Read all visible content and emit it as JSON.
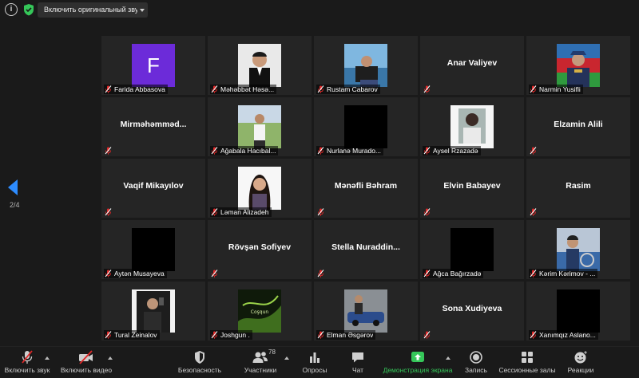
{
  "topbar": {
    "original_sound_label": "Включить оригинальный звук"
  },
  "pager": {
    "page_label": "2/4"
  },
  "participants": [
    {
      "name": "Farida Abbasova",
      "display": "avatar",
      "initial": "F",
      "avatar_color": "#6c2bd9"
    },
    {
      "name": "Məhəbbət Həsə...",
      "display": "photo"
    },
    {
      "name": "Rustam Cabarov",
      "display": "photo"
    },
    {
      "name": "Anar Valiyev",
      "display": "name"
    },
    {
      "name": "Narmin Yusifli",
      "display": "photo"
    },
    {
      "name": "Mirməhəmməd...",
      "display": "name"
    },
    {
      "name": "Ağabala Hacıbal...",
      "display": "photo"
    },
    {
      "name": "Nurlanə Murado...",
      "display": "photo"
    },
    {
      "name": "Aysel Rzazadə",
      "display": "photo"
    },
    {
      "name": "Elzamin Alili",
      "display": "name"
    },
    {
      "name": "Vaqif Mikayılov",
      "display": "name"
    },
    {
      "name": "Ləman Alizadeh",
      "display": "photo"
    },
    {
      "name": "Mənəfli Bəhram",
      "display": "name"
    },
    {
      "name": "Elvin Babayev",
      "display": "name"
    },
    {
      "name": "Rasim",
      "display": "name"
    },
    {
      "name": "Aytən Musayeva",
      "display": "photo"
    },
    {
      "name": "Rövşən Sofiyev",
      "display": "name"
    },
    {
      "name": "Stella  Nuraddin...",
      "display": "name"
    },
    {
      "name": "Ağca Bağırzadə",
      "display": "photo"
    },
    {
      "name": "Kərim Kərimov - ...",
      "display": "photo"
    },
    {
      "name": "Tural Zeinalov",
      "display": "photo"
    },
    {
      "name": "Joshgun .",
      "display": "photo"
    },
    {
      "name": "Elman Əsgərov",
      "display": "photo"
    },
    {
      "name": "Sona Xudiyeva",
      "display": "name"
    },
    {
      "name": "Xanımqız Aslano...",
      "display": "photo"
    }
  ],
  "toolbar": {
    "unmute_label": "Включить звук",
    "start_video_label": "Включить видео",
    "security_label": "Безопасность",
    "participants_label": "Участники",
    "participants_count": "78",
    "polls_label": "Опросы",
    "chat_label": "Чат",
    "share_label": "Демонстрация экрана",
    "record_label": "Запись",
    "breakout_label": "Сессионные залы",
    "reactions_label": "Реакции"
  },
  "colors": {
    "share_green": "#35c759",
    "muted_red": "#e02828",
    "pager_blue": "#2d8cff"
  }
}
